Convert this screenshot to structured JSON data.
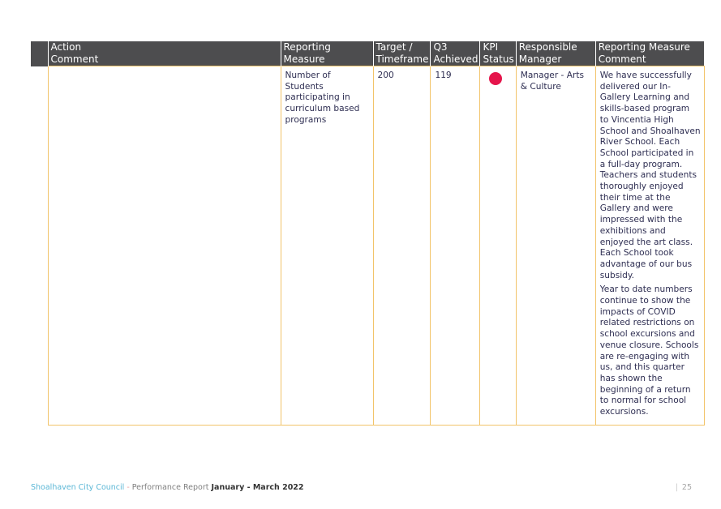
{
  "table": {
    "headers": [
      {
        "line1": "Action",
        "line2": "Comment"
      },
      {
        "line1": "Reporting",
        "line2": "Measure"
      },
      {
        "line1": "Target /",
        "line2": "Timeframe"
      },
      {
        "line1": "Q3",
        "line2": "Achieved"
      },
      {
        "line1": "KPI",
        "line2": "Status"
      },
      {
        "line1": "Responsible",
        "line2": "Manager"
      },
      {
        "line1": "Reporting Measure",
        "line2": "Comment"
      }
    ],
    "rows": [
      {
        "action_comment": "",
        "reporting_measure": "Number of Students participating in curriculum based programs",
        "target": "200",
        "q3_achieved": "119",
        "kpi_status": "red",
        "kpi_status_color": "#e5154b",
        "responsible_manager": "Manager - Arts & Culture",
        "comment_paragraphs": [
          "We have successfully delivered our In-Gallery Learning and skills-based program to Vincentia High School and Shoalhaven River School. Each School participated in a full-day program. Teachers and students thoroughly enjoyed their time at the Gallery and were impressed with the exhibitions and enjoyed the art class. Each School took advantage of our bus subsidy.",
          "Year to date numbers continue to show the impacts of COVID related restrictions on school excursions and venue closure. Schools are re-engaging with us, and this quarter has shown the beginning of a return to normal for school excursions."
        ]
      }
    ]
  },
  "footer": {
    "organization": "Shoalhaven City Council",
    "separator": " - ",
    "report_name": "Performance Report ",
    "period": "January - March 2022",
    "page_separator": "|",
    "page_number": "25"
  },
  "colors": {
    "header_bg": "#4d4d4f",
    "cell_border": "#f2c46a",
    "brand_blue": "#5bb7d6"
  }
}
